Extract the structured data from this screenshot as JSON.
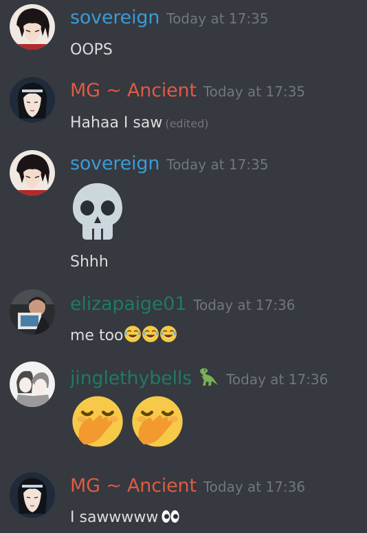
{
  "colors": {
    "background": "#36393f",
    "sovereign": "#3a9bd6",
    "mg_ancient": "#e05a45",
    "elizapaige": "#1f7a62",
    "jingle": "#1f7a62",
    "timestamp": "#72767d",
    "text": "#dcddde"
  },
  "messages": [
    {
      "username": "sovereign",
      "timestamp": "Today at 17:35",
      "text": "OOPS"
    },
    {
      "username": "MG ~ Ancient",
      "timestamp": "Today at 17:35",
      "text": "Hahaa I saw",
      "edited": "(edited)"
    },
    {
      "username": "sovereign",
      "timestamp": "Today at 17:35",
      "emoji": "skull",
      "text": "Shhh"
    },
    {
      "username": "elizapaige01",
      "timestamp": "Today at 17:36",
      "text": "me too",
      "emojis": [
        "face-with-tears-of-joy",
        "face-with-tears-of-joy",
        "face-with-tears-of-joy"
      ]
    },
    {
      "username": "jinglethybells",
      "username_emoji": "t-rex",
      "timestamp": "Today at 17:36",
      "emojis": [
        "face-with-hand-over-mouth",
        "face-with-hand-over-mouth"
      ]
    },
    {
      "username": "MG ~ Ancient",
      "timestamp": "Today at 17:36",
      "text": "I sawwwww",
      "emojis": [
        "eyes"
      ]
    }
  ]
}
